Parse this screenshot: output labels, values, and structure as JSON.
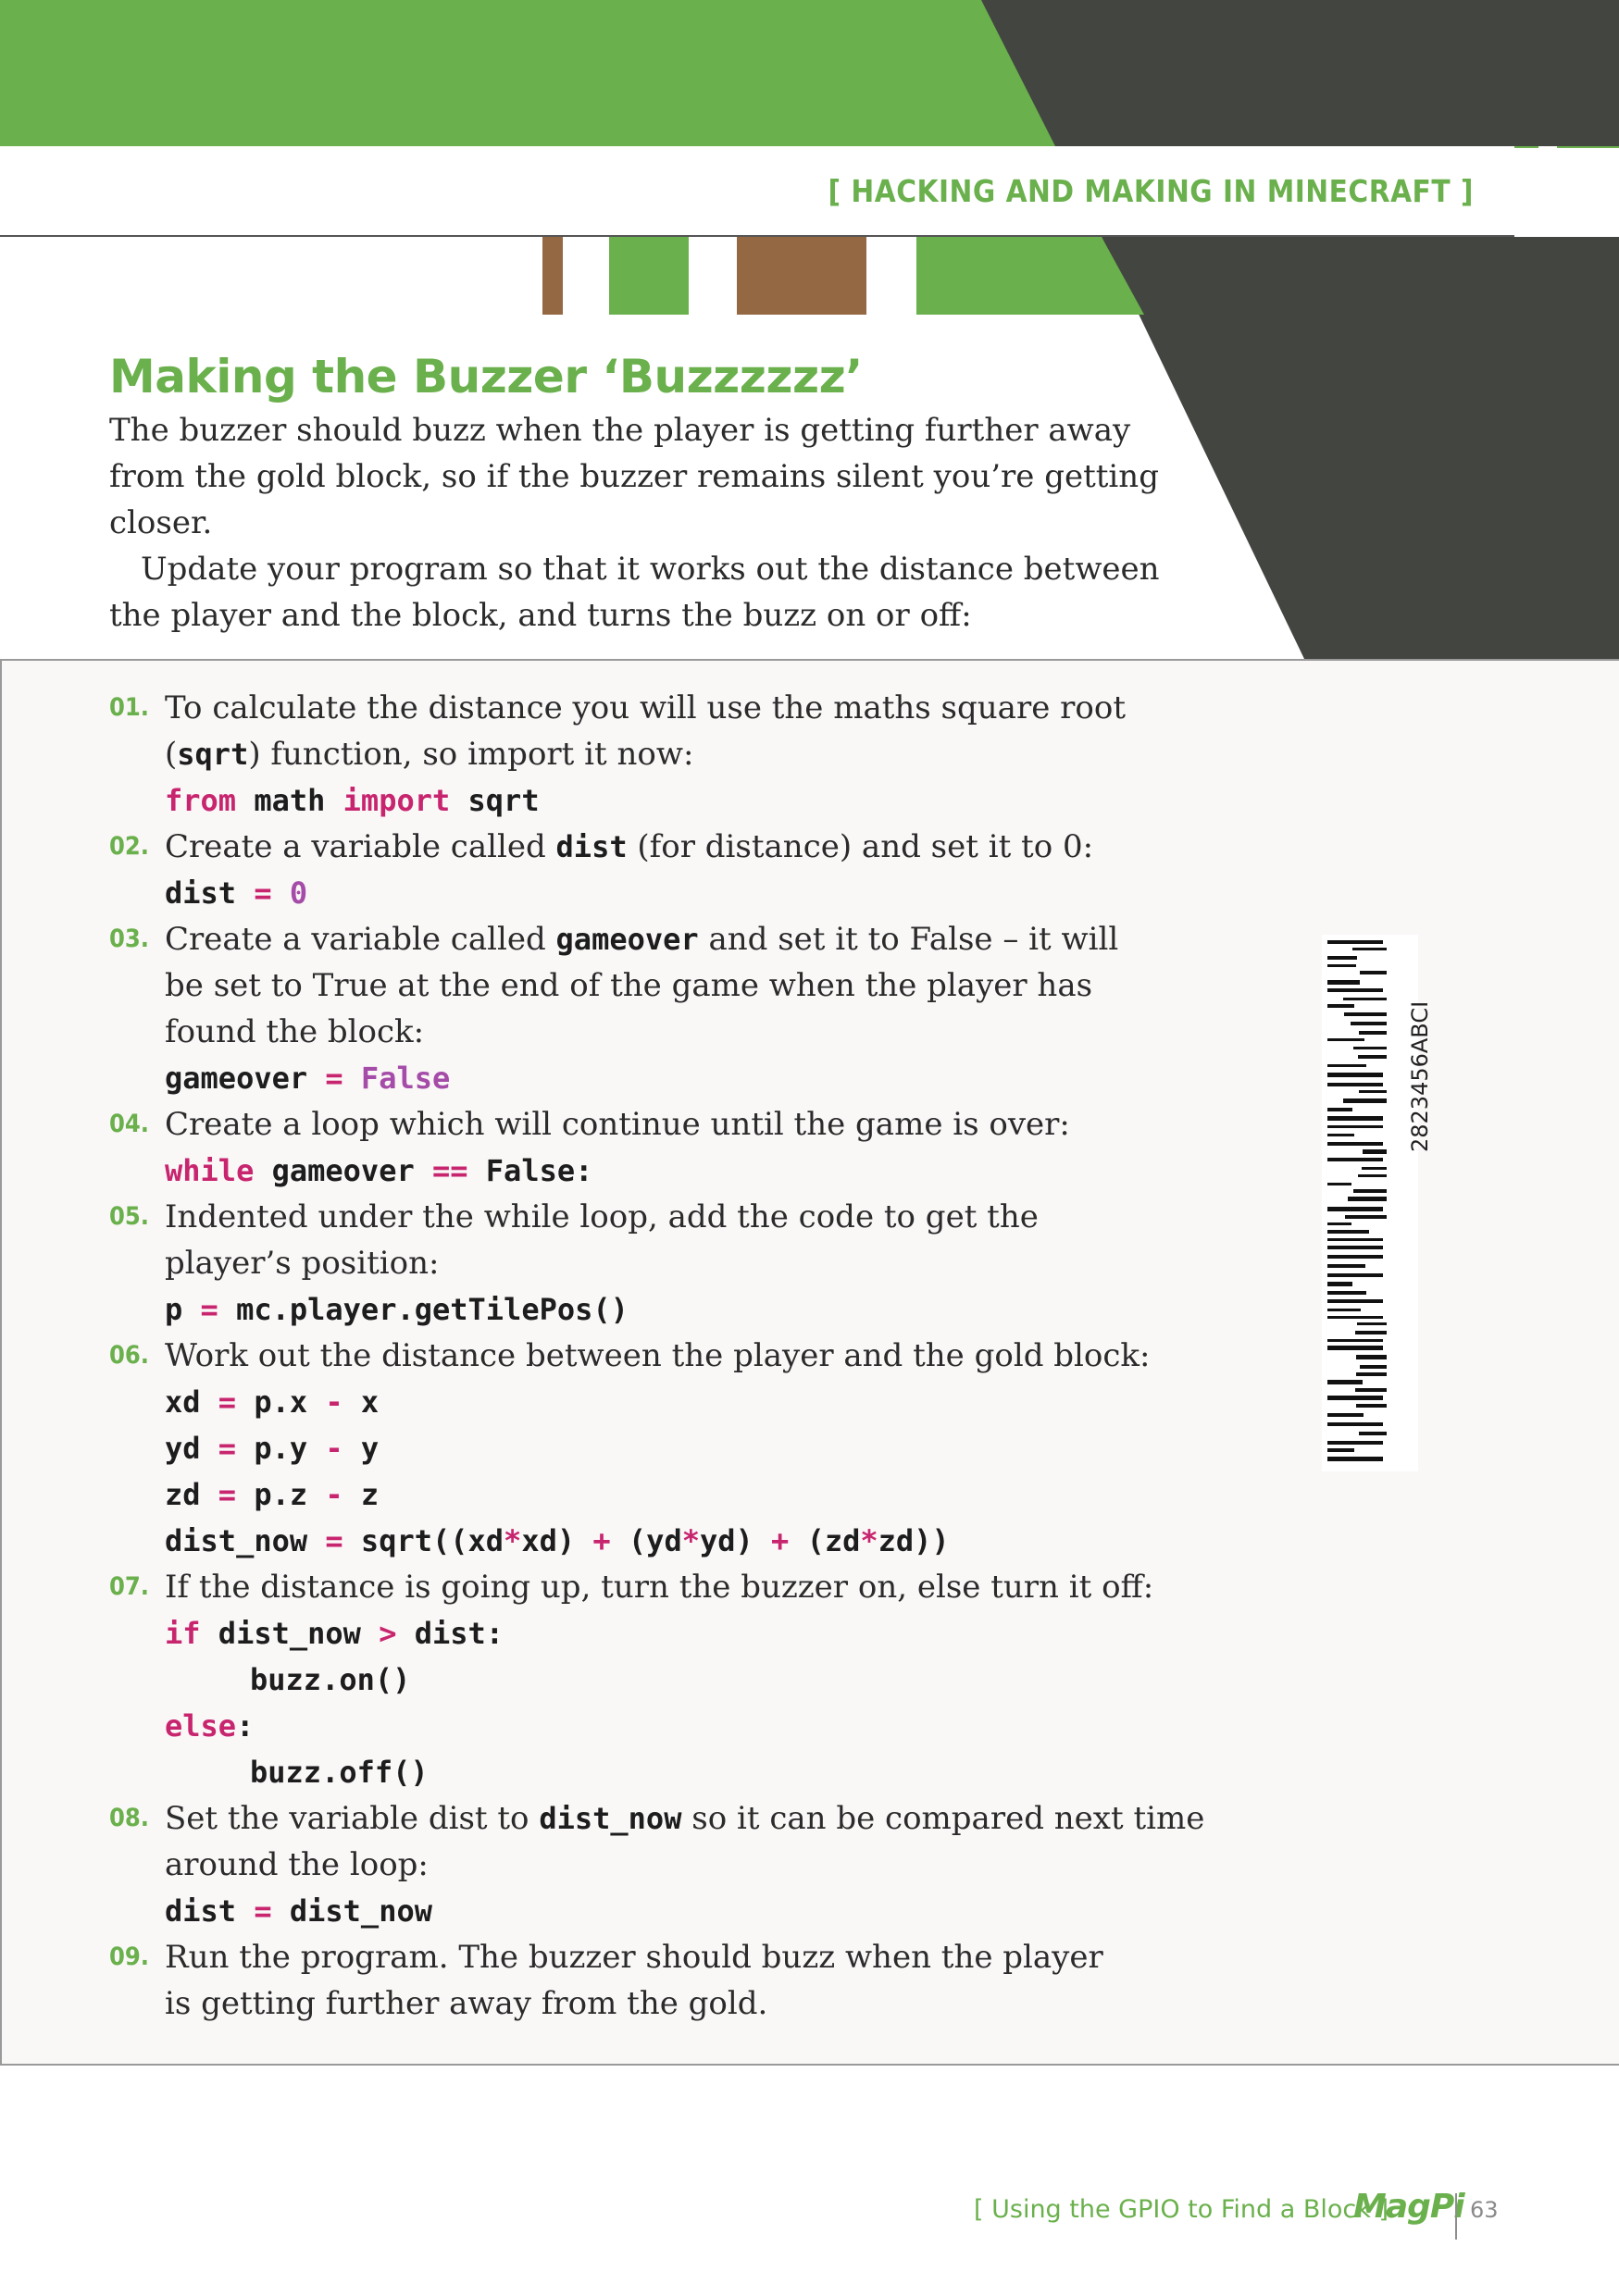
{
  "header": {
    "title": "[ HACKING AND MAKING IN MINECRAFT ]"
  },
  "section": {
    "title": "Making the Buzzer ‘Buzzzzzz’",
    "paragraphs": [
      "The buzzer should buzz when the player is getting further away from the gold block, so if the buzzer remains silent you’re getting closer.",
      "Update your program so that it works out the distance between the player and the block, and turns the buzz on or off:"
    ]
  },
  "steps": [
    {
      "num": "01.",
      "text_a": "To calculate the distance you will use the maths square root (",
      "code": "sqrt",
      "text_b": ") function, so import it now:"
    },
    {
      "num": "02.",
      "text_a": "Create a variable called ",
      "code": "dist",
      "text_b": " (for distance) and set it to 0:"
    },
    {
      "num": "03.",
      "text_a": "Create a variable called ",
      "code": "gameover",
      "text_b": " and set it to False – it will be set to True at the end of the game when the player has found the block:"
    },
    {
      "num": "04.",
      "text": "Create a loop which will continue until the game is over:"
    },
    {
      "num": "05.",
      "text": "Indented under the while loop, add the code to get the player’s position:"
    },
    {
      "num": "06.",
      "text": "Work out the distance between the player and the gold block:"
    },
    {
      "num": "07.",
      "text": "If the distance is going up, turn the buzzer on, else turn it off:"
    },
    {
      "num": "08.",
      "text_a": "Set the variable dist to ",
      "code": "dist_now",
      "text_b": " so it can be compared next time around the loop:"
    },
    {
      "num": "09.",
      "text": "Run the program. The buzzer should buzz when the player is getting further away from the gold."
    }
  ],
  "code": {
    "s1": {
      "from": "from",
      "math": " math ",
      "import": "import",
      "sqrt": " sqrt"
    },
    "s2": {
      "var": "dist",
      "eq": "=",
      "val": "0"
    },
    "s3": {
      "var": "gameover",
      "eq": "=",
      "val": "False"
    },
    "s4": {
      "while": "while",
      "var": " gameover ",
      "op": "==",
      "val": " False:"
    },
    "s5": {
      "var": "p",
      "eq": "=",
      "expr": "mc.player.getTilePos()"
    },
    "s6": {
      "l1": {
        "var": "xd",
        "eq": "=",
        "a": "p.x",
        "op": "-",
        "b": "x"
      },
      "l2": {
        "var": "yd",
        "eq": "=",
        "a": "p.y",
        "op": "-",
        "b": "y"
      },
      "l3": {
        "var": "zd",
        "eq": "=",
        "a": "p.z",
        "op": "-",
        "b": "z"
      },
      "l4": {
        "var": "dist_now",
        "eq": "=",
        "p1": "sqrt((xd",
        "m1": "*",
        "p2": "xd)",
        "plus1": "+",
        "p3": "(yd",
        "m2": "*",
        "p4": "yd)",
        "plus2": "+",
        "p5": "(zd",
        "m3": "*",
        "p6": "zd))"
      }
    },
    "s7": {
      "if": "if",
      "cond_a": " dist_now ",
      "gt": ">",
      "cond_b": " dist:",
      "on": "buzz.on()",
      "else": "else",
      "colon": ":",
      "off": "buzz.off()"
    },
    "s8": {
      "var": "dist",
      "eq": "=",
      "val": "dist_now"
    }
  },
  "barcode": {
    "text": "2823456ABCI"
  },
  "footer": {
    "text": "[ Using the GPIO to Find a Block ]",
    "logo": "MagPi",
    "page": "63"
  },
  "colors": {
    "green": "#6ab04c",
    "dark": "#434541",
    "brown": "#946842",
    "keyword": "#c8256f",
    "literal": "#a44ca8"
  }
}
